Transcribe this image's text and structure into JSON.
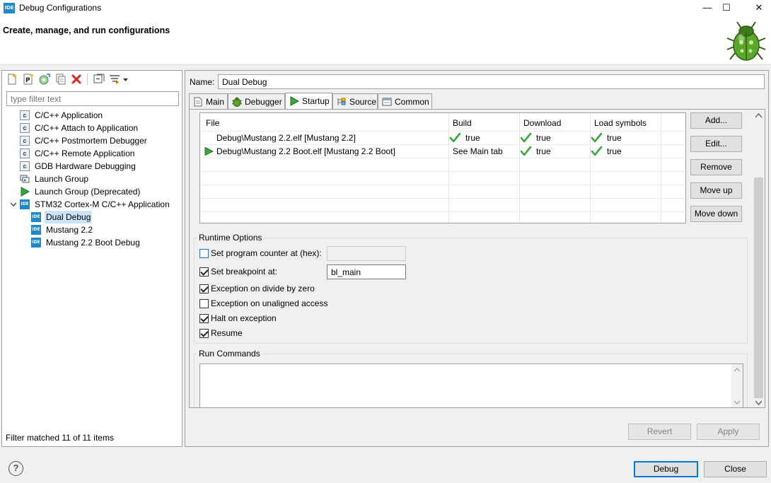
{
  "window": {
    "title": "Debug Configurations",
    "app_icon": "IDE",
    "minimize": "—",
    "maximize": "☐",
    "close": "✕"
  },
  "header": {
    "title": "Create, manage, and run configurations",
    "logo_icon": "debug-bug-icon"
  },
  "left": {
    "filter_placeholder": "type filter text",
    "tree": [
      {
        "label": "C/C++ Application",
        "icon": "c-icon",
        "level": 1
      },
      {
        "label": "C/C++ Attach to Application",
        "icon": "c-icon",
        "level": 1
      },
      {
        "label": "C/C++ Postmortem Debugger",
        "icon": "c-icon",
        "level": 1
      },
      {
        "label": "C/C++ Remote Application",
        "icon": "c-icon",
        "level": 1
      },
      {
        "label": "GDB Hardware Debugging",
        "icon": "c-icon",
        "level": 1
      },
      {
        "label": "Launch Group",
        "icon": "launch-group-icon",
        "level": 1
      },
      {
        "label": "Launch Group (Deprecated)",
        "icon": "play-icon",
        "level": 1
      },
      {
        "label": "STM32 Cortex-M C/C++ Application",
        "icon": "ide-icon",
        "level": 1,
        "expanded": true
      },
      {
        "label": "Dual Debug",
        "icon": "ide-icon",
        "level": 2,
        "selected": true
      },
      {
        "label": "Mustang 2.2",
        "icon": "ide-icon",
        "level": 2
      },
      {
        "label": "Mustang 2.2 Boot Debug",
        "icon": "ide-icon",
        "level": 2
      }
    ],
    "filter_status": "Filter matched 11 of 11 items"
  },
  "right": {
    "name_label": "Name:",
    "name_value": "Dual Debug",
    "tabs": [
      {
        "label": "Main",
        "icon": "main-tab-icon"
      },
      {
        "label": "Debugger",
        "icon": "debugger-bug-icon"
      },
      {
        "label": "Startup",
        "icon": "play-icon",
        "active": true
      },
      {
        "label": "Source",
        "icon": "source-icon"
      },
      {
        "label": "Common",
        "icon": "common-icon"
      }
    ],
    "table": {
      "headers": [
        "File",
        "Build",
        "Download",
        "Load symbols"
      ],
      "rows": [
        {
          "file": "Debug\\Mustang 2.2.elf [Mustang 2.2]",
          "build": "true",
          "download": "true",
          "load_symbols": "true",
          "build_check": true,
          "marker": false
        },
        {
          "file": "Debug\\Mustang 2.2 Boot.elf [Mustang 2.2 Boot]",
          "build": "See Main tab",
          "download": "true",
          "load_symbols": "true",
          "build_check": false,
          "marker": true
        }
      ]
    },
    "buttons": {
      "add": "Add...",
      "edit": "Edit...",
      "remove": "Remove",
      "move_up": "Move up",
      "move_down": "Move down"
    },
    "runtime": {
      "title": "Runtime Options",
      "set_pc_label": "Set program counter at (hex):",
      "set_pc_checked": false,
      "set_pc_value": "",
      "set_bp_label": "Set breakpoint at:",
      "set_bp_checked": true,
      "set_bp_value": "bl_main",
      "exc_div_label": "Exception on divide by zero",
      "exc_div_checked": true,
      "exc_unaligned_label": "Exception on unaligned access",
      "exc_unaligned_checked": false,
      "halt_label": "Halt on exception",
      "halt_checked": true,
      "resume_label": "Resume",
      "resume_checked": true
    },
    "run_commands": {
      "title": "Run Commands",
      "value": ""
    },
    "revert": "Revert",
    "apply": "Apply"
  },
  "footer": {
    "help": "?",
    "debug": "Debug",
    "close": "Close"
  },
  "colors": {
    "accent": "#0078d7",
    "selection": "#cce4f7",
    "ide_blue": "#1e88c8",
    "check_green": "#3aa83a"
  }
}
